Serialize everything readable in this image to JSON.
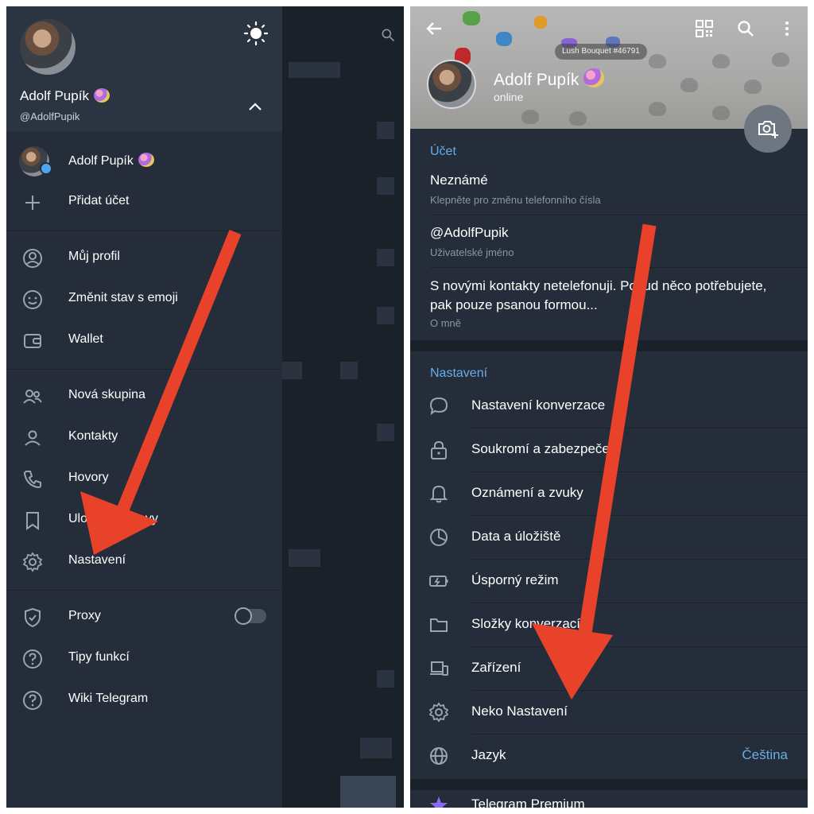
{
  "left_panel": {
    "header": {
      "name": "Adolf Pupík",
      "username": "@AdolfPupik"
    },
    "accounts": [
      {
        "label": "Adolf Pupík"
      },
      {
        "label": "Přidat účet",
        "icon": "plus-icon"
      }
    ],
    "menu_group_1": [
      {
        "label": "Můj profil",
        "icon": "profile-icon"
      },
      {
        "label": "Změnit stav s emoji",
        "icon": "emoji-icon"
      },
      {
        "label": "Wallet",
        "icon": "wallet-icon"
      }
    ],
    "menu_group_2": [
      {
        "label": "Nová skupina",
        "icon": "group-icon"
      },
      {
        "label": "Kontakty",
        "icon": "contact-icon"
      },
      {
        "label": "Hovory",
        "icon": "phone-icon"
      },
      {
        "label": "Uložené zprávy",
        "visible_label": "Ulož",
        "icon": "bookmark-icon"
      },
      {
        "label": "Nastavení",
        "icon": "gear-icon"
      }
    ],
    "menu_group_3": [
      {
        "label": "Proxy",
        "icon": "shield-icon",
        "toggle": false
      },
      {
        "label": "Tipy funkcí",
        "icon": "help-icon"
      },
      {
        "label": "Wiki Telegram",
        "icon": "help-icon"
      }
    ],
    "partial_texts": [
      "avy"
    ]
  },
  "right_panel": {
    "header": {
      "gift_label": "Lush Bouquet #46791",
      "name": "Adolf Pupík",
      "status": "online"
    },
    "account_section": {
      "title": "Účet",
      "phone": {
        "value": "Neznámé",
        "hint": "Klepněte pro změnu telefonního čísla"
      },
      "username": {
        "value": "@AdolfPupik",
        "hint": "Uživatelské jméno"
      },
      "bio": {
        "line1": "S novými kontakty netelefonuji. Pokud něco potřebujete,",
        "line2": "pak pouze psanou formou...",
        "hint": "O mně"
      }
    },
    "settings_section": {
      "title": "Nastavení",
      "items": [
        {
          "label": "Nastavení konverzace",
          "icon": "chat-bubble-icon"
        },
        {
          "label": "Soukromí a zabezpečení",
          "icon": "lock-icon"
        },
        {
          "label": "Oznámení a zvuky",
          "icon": "bell-icon"
        },
        {
          "label": "Data a úložiště",
          "icon": "pie-chart-icon"
        },
        {
          "label": "Úsporný režim",
          "icon": "battery-icon"
        },
        {
          "label": "Složky konverzací",
          "icon": "folder-icon"
        },
        {
          "label": "Zařízení",
          "icon": "devices-icon"
        },
        {
          "label": "Neko Nastavení",
          "icon": "gear-icon"
        },
        {
          "label": "Jazyk",
          "icon": "globe-icon",
          "value": "Čeština"
        }
      ]
    },
    "premium": {
      "label": "Telegram Premium",
      "icon": "star-icon"
    }
  },
  "colors": {
    "drawer_bg": "#242d39",
    "accent_blue": "#66aeea",
    "arrow_red": "#e8432a"
  }
}
